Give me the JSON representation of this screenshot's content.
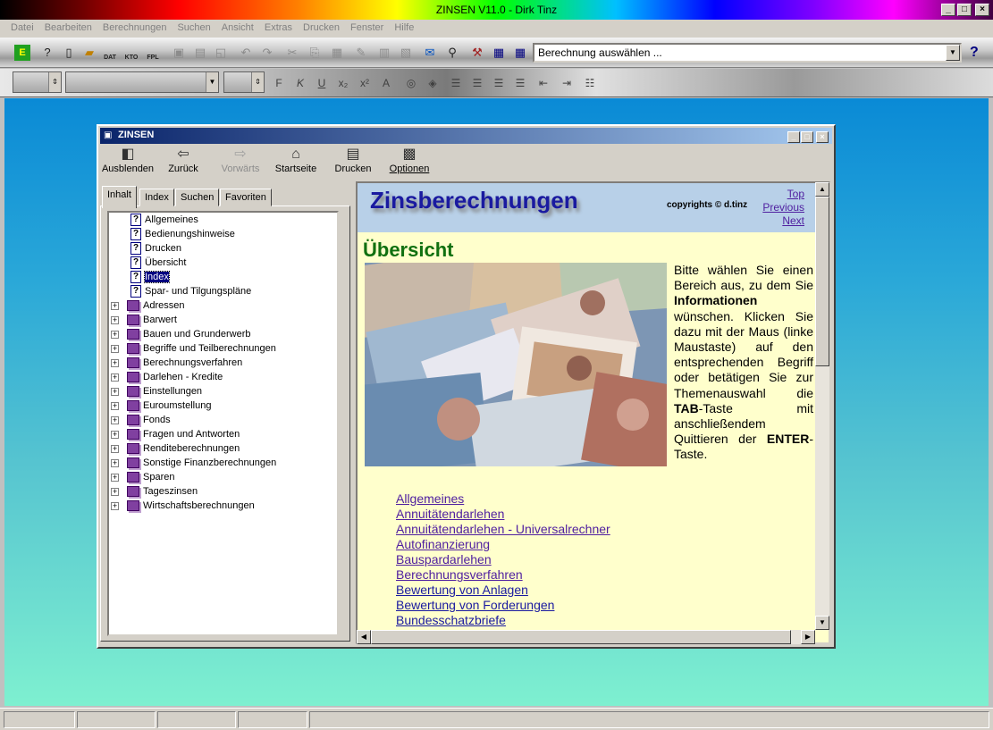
{
  "app": {
    "title": "ZINSEN V11.0 - Dirk Tinz"
  },
  "menu": [
    "Datei",
    "Bearbeiten",
    "Berechnungen",
    "Suchen",
    "Ansicht",
    "Extras",
    "Drucken",
    "Fenster",
    "Hilfe"
  ],
  "toolbar": {
    "dat_label": "DAT",
    "kto_label": "KTO",
    "fpl_label": "FPL",
    "calc_select": "Berechnung auswählen ...",
    "help": "?",
    "format": {
      "bold": "F",
      "italic": "K",
      "underline": "U"
    }
  },
  "help_window": {
    "title": "ZINSEN",
    "buttons": {
      "hide": "Ausblenden",
      "back": "Zurück",
      "forward": "Vorwärts",
      "home": "Startseite",
      "print": "Drucken",
      "options": "Optionen"
    },
    "tabs": {
      "contents": "Inhalt",
      "index": "Index",
      "search": "Suchen",
      "favorites": "Favoriten"
    },
    "tree": {
      "topics": [
        "Allgemeines",
        "Bedienungshinweise",
        "Drucken",
        "Übersicht",
        "Index",
        "Spar- und Tilgungspläne"
      ],
      "selected": "Index",
      "books": [
        "Adressen",
        "Barwert",
        "Bauen und Grunderwerb",
        "Begriffe und Teilberechnungen",
        "Berechnungsverfahren",
        "Darlehen - Kredite",
        "Einstellungen",
        "Euroumstellung",
        "Fonds",
        "Fragen und Antworten",
        "Renditeberechnungen",
        "Sonstige Finanzberechnungen",
        "Sparen",
        "Tageszinsen",
        "Wirtschaftsberechnungen"
      ]
    },
    "content": {
      "banner_title": "Zinsberechnungen",
      "copyright": "copyrights © d.tinz",
      "nav": {
        "top": "Top",
        "previous": "Previous",
        "next": "Next"
      },
      "heading": "Übersicht",
      "description_parts": [
        "Bitte wählen Sie einen Bereich aus, zu dem Sie ",
        "Informationen",
        " wünschen. Klicken Sie dazu mit der Maus (linke Maustaste) auf den entsprechenden Begriff oder betätigen Sie zur Themenauswahl die ",
        "TAB",
        "-Taste mit anschließendem Quittieren der ",
        "ENTER",
        "-Taste."
      ],
      "links": [
        "Allgemeines",
        "Annuitätendarlehen",
        "Annuitätendarlehen - Universalrechner",
        "Autofinanzierung",
        "Bauspardarlehen",
        "Berechnungsverfahren",
        "Bewertung von Anlagen",
        "Bewertung von Forderungen",
        "Bundesschatzbriefe"
      ]
    }
  }
}
